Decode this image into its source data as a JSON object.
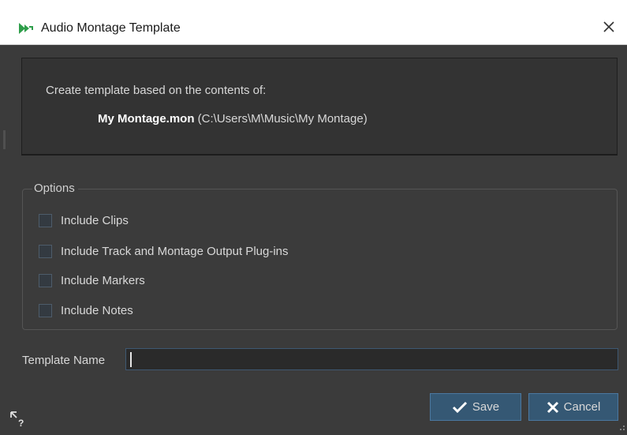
{
  "window": {
    "title": "Audio Montage Template",
    "close_glyph": "✕"
  },
  "info": {
    "intro": "Create template based on the contents of:",
    "filename": "My Montage.mon",
    "path": " (C:\\Users\\M\\Music\\My Montage)"
  },
  "options": {
    "legend": "Options",
    "items": [
      {
        "label": "Include Clips",
        "checked": false
      },
      {
        "label": "Include Track and Montage Output Plug-ins",
        "checked": false
      },
      {
        "label": "Include Markers",
        "checked": false
      },
      {
        "label": "Include Notes",
        "checked": false
      }
    ]
  },
  "template_name": {
    "label": "Template Name",
    "value": ""
  },
  "buttons": {
    "save": "Save",
    "cancel": "Cancel"
  },
  "colors": {
    "background": "#3b3b3b",
    "panel": "#333333",
    "button": "#355874",
    "accent_green": "#2e9e4a"
  },
  "icons": {
    "app": "wavelab-logo-icon",
    "close": "close-icon",
    "save": "checkmark-icon",
    "cancel": "x-icon",
    "help": "whats-this-help-icon"
  }
}
